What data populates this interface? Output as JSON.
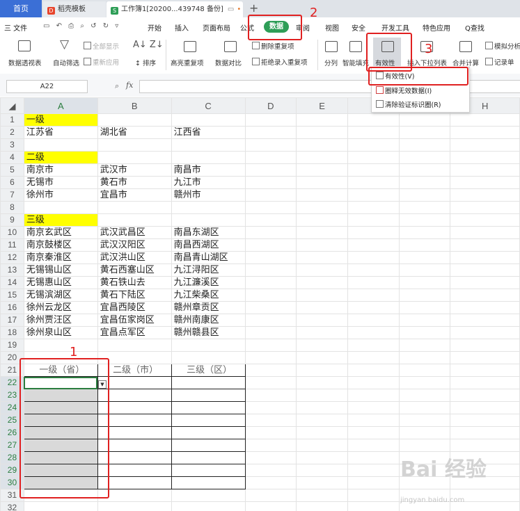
{
  "tabs": {
    "home": "首页",
    "template": "稻壳模板",
    "document": "工作簿1[20200...439748 备份]",
    "new_tab": "+"
  },
  "menu": {
    "file": "三 文件",
    "items": [
      "开始",
      "插入",
      "页面布局",
      "公式",
      "审阅",
      "视图",
      "安全",
      "开发工具",
      "特色应用"
    ],
    "active": "数据",
    "search": "Q查找"
  },
  "ribbon": {
    "pivot": "数据透视表",
    "autofilter": "自动筛选",
    "show_all": "全部显示",
    "reapply": "重新应用",
    "sort": "排序",
    "highlight_dup": "高亮重复项",
    "compare": "数据对比",
    "remove_dup": "删除重复项",
    "reject_dup": "拒绝录入重复项",
    "split": "分列",
    "smart_fill": "智能填充",
    "validity": "有效性",
    "insert_dropdown": "插入下拉列表",
    "consolidate": "合并计算",
    "simulate": "模拟分析",
    "record": "记录单"
  },
  "validity_menu": [
    "有效性(V)",
    "圈释无效数据(I)",
    "清除验证标识圈(R)"
  ],
  "formula_bar": {
    "name_box": "A22",
    "fx": "fx",
    "value": ""
  },
  "columns": [
    "A",
    "B",
    "C",
    "D",
    "E",
    "F",
    "G",
    "H"
  ],
  "rows": [
    {
      "n": "1",
      "a": "一级",
      "b": "",
      "c": ""
    },
    {
      "n": "2",
      "a": "江苏省",
      "b": "湖北省",
      "c": "江西省"
    },
    {
      "n": "3",
      "a": "",
      "b": "",
      "c": ""
    },
    {
      "n": "4",
      "a": "二级",
      "b": "",
      "c": ""
    },
    {
      "n": "5",
      "a": "南京市",
      "b": "武汉市",
      "c": "南昌市"
    },
    {
      "n": "6",
      "a": "无锡市",
      "b": "黄石市",
      "c": "九江市"
    },
    {
      "n": "7",
      "a": "徐州市",
      "b": "宜昌市",
      "c": "赣州市"
    },
    {
      "n": "8",
      "a": "",
      "b": "",
      "c": ""
    },
    {
      "n": "9",
      "a": "三级",
      "b": "",
      "c": ""
    },
    {
      "n": "10",
      "a": "南京玄武区",
      "b": "武汉武昌区",
      "c": "南昌东湖区"
    },
    {
      "n": "11",
      "a": "南京鼓楼区",
      "b": "武汉汉阳区",
      "c": "南昌西湖区"
    },
    {
      "n": "12",
      "a": "南京秦淮区",
      "b": "武汉洪山区",
      "c": "南昌青山湖区"
    },
    {
      "n": "13",
      "a": "无锡锡山区",
      "b": "黄石西塞山区",
      "c": "九江浔阳区"
    },
    {
      "n": "14",
      "a": "无锡惠山区",
      "b": "黄石铁山去",
      "c": "九江濂溪区"
    },
    {
      "n": "15",
      "a": "无锡滨湖区",
      "b": "黄石下陆区",
      "c": "九江柴桑区"
    },
    {
      "n": "16",
      "a": "徐州云龙区",
      "b": "宜昌西陵区",
      "c": "赣州章贡区"
    },
    {
      "n": "17",
      "a": "徐州贾汪区",
      "b": "宜昌伍家岗区",
      "c": "赣州南康区"
    },
    {
      "n": "18",
      "a": "徐州泉山区",
      "b": "宜昌点军区",
      "c": "赣州赣县区"
    },
    {
      "n": "19",
      "a": "",
      "b": "",
      "c": ""
    },
    {
      "n": "20",
      "a": "",
      "b": "",
      "c": ""
    },
    {
      "n": "21",
      "a": "一级（省）",
      "b": "二级（市）",
      "c": "三级（区）"
    },
    {
      "n": "22",
      "a": "",
      "b": "",
      "c": ""
    },
    {
      "n": "23",
      "a": "",
      "b": "",
      "c": ""
    },
    {
      "n": "24",
      "a": "",
      "b": "",
      "c": ""
    },
    {
      "n": "25",
      "a": "",
      "b": "",
      "c": ""
    },
    {
      "n": "26",
      "a": "",
      "b": "",
      "c": ""
    },
    {
      "n": "27",
      "a": "",
      "b": "",
      "c": ""
    },
    {
      "n": "28",
      "a": "",
      "b": "",
      "c": ""
    },
    {
      "n": "29",
      "a": "",
      "b": "",
      "c": ""
    },
    {
      "n": "30",
      "a": "",
      "b": "",
      "c": ""
    },
    {
      "n": "31",
      "a": "",
      "b": "",
      "c": ""
    },
    {
      "n": "32",
      "a": "",
      "b": "",
      "c": ""
    }
  ],
  "annotations": [
    "1",
    "2",
    "3"
  ],
  "watermark": {
    "logo": "Bai 经验",
    "url": "jingyan.baidu.com"
  },
  "colors": {
    "accent_green": "#2e9e57",
    "annotation_red": "#e02020",
    "level_header": "#ffff00",
    "tab_blue": "#3b6fd6"
  }
}
